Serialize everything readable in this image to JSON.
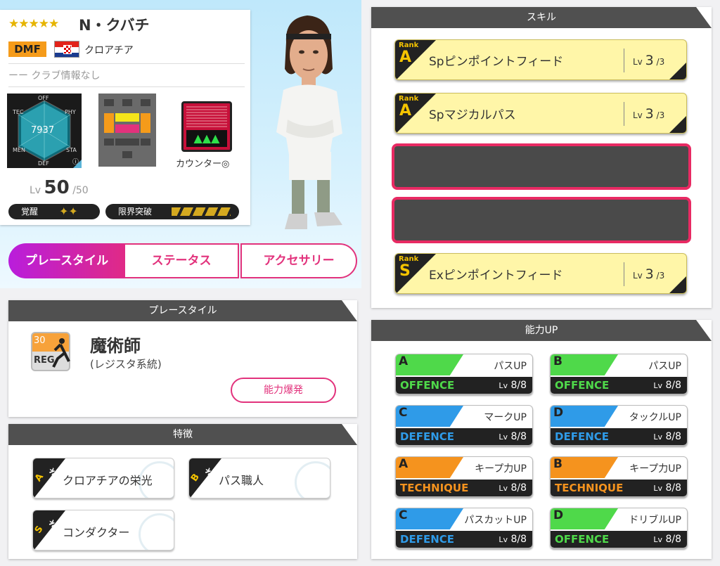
{
  "player": {
    "stars": "★★★★★",
    "name": "N・クバチ",
    "position": "DMF",
    "country": "クロアチア",
    "club_dash": "ーー",
    "club": "クラブ情報なし",
    "overall": "7937",
    "radar_labels": {
      "off": "OFF",
      "tec": "TEC",
      "phy": "PHY",
      "men": "MEN",
      "sta": "STA",
      "def": "DEF"
    },
    "play_type_label": "カウンター◎",
    "lv_prefix": "Lv",
    "level": "50",
    "level_max": "/50",
    "awaken_label": "覚醒",
    "awaken_marks": "✦✦",
    "limit_label": "限界突破"
  },
  "tabs": {
    "playstyle": "プレースタイル",
    "status": "ステータス",
    "accessory": "アクセサリー"
  },
  "playstyle": {
    "header": "プレースタイル",
    "icon_level": "30",
    "icon_code": "REG",
    "name": "魔術師",
    "sub": "(レジスタ系統)",
    "button": "能力爆発"
  },
  "traits": {
    "header": "特徴",
    "rank_word": "Rank",
    "items": [
      {
        "rank": "A",
        "label": "クロアチアの栄光"
      },
      {
        "rank": "B",
        "label": "パス職人"
      },
      {
        "rank": "S",
        "label": "コンダクター"
      }
    ]
  },
  "skills": {
    "header": "スキル",
    "rank_word": "Rank",
    "lv_word": "Lv",
    "items": [
      {
        "rank": "A",
        "name": "Spピンポイントフィード",
        "lv": "3",
        "max": "/3"
      },
      {
        "rank": "A",
        "name": "Spマジカルパス",
        "lv": "3",
        "max": "/3"
      },
      {
        "rank": "S",
        "name": "Exピンポイントフィード",
        "lv": "3",
        "max": "/3"
      }
    ]
  },
  "abilities": {
    "header": "能力UP",
    "lv_word": "Lv",
    "items": [
      {
        "grade": "A",
        "name": "パスUP",
        "category": "OFFENCE",
        "lv": "8/8",
        "color": "#4fd94a"
      },
      {
        "grade": "B",
        "name": "パスUP",
        "category": "OFFENCE",
        "lv": "8/8",
        "color": "#4fd94a"
      },
      {
        "grade": "C",
        "name": "マークUP",
        "category": "DEFENCE",
        "lv": "8/8",
        "color": "#2f9be8"
      },
      {
        "grade": "D",
        "name": "タックルUP",
        "category": "DEFENCE",
        "lv": "8/8",
        "color": "#2f9be8"
      },
      {
        "grade": "A",
        "name": "キープ力UP",
        "category": "TECHNIQUE",
        "lv": "8/8",
        "color": "#f5931e"
      },
      {
        "grade": "B",
        "name": "キープ力UP",
        "category": "TECHNIQUE",
        "lv": "8/8",
        "color": "#f5931e"
      },
      {
        "grade": "C",
        "name": "パスカットUP",
        "category": "DEFENCE",
        "lv": "8/8",
        "color": "#2f9be8"
      },
      {
        "grade": "D",
        "name": "ドリブルUP",
        "category": "OFFENCE",
        "lv": "8/8",
        "color": "#4fd94a"
      }
    ]
  },
  "colors": {
    "accent": "#e2327c",
    "position_badge": "#f59b1a",
    "skill_bg": "#fff6a8",
    "rank_gold": "#f5c400"
  }
}
